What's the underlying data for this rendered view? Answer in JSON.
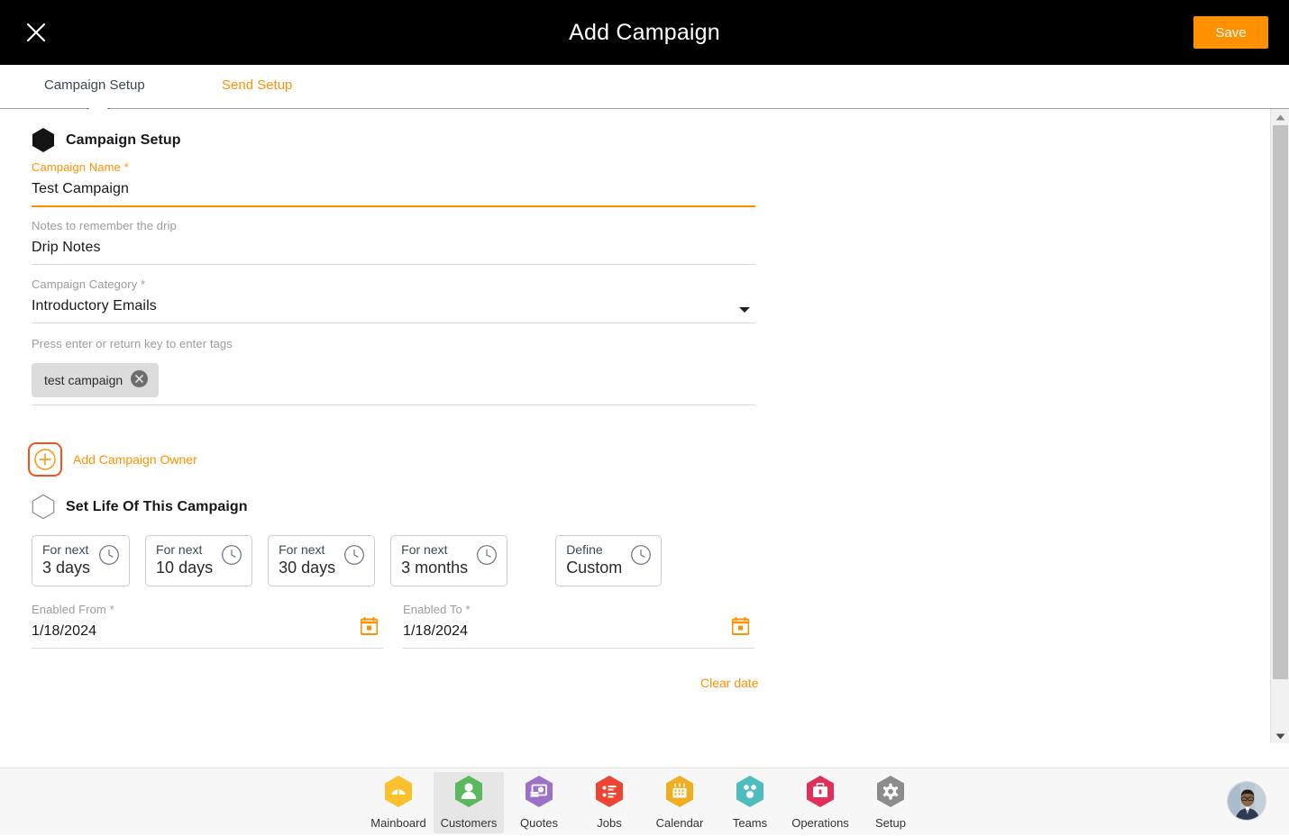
{
  "header": {
    "title": "Add Campaign",
    "close_icon": "close-icon",
    "save_label": "Save"
  },
  "tabs": [
    {
      "label": "Campaign Setup",
      "active": true
    },
    {
      "label": "Send Setup",
      "active": false
    }
  ],
  "sections": {
    "campaign_setup": {
      "title": "Campaign Setup",
      "icon": "hexagon-filled-icon"
    },
    "set_life": {
      "title": "Set Life Of This Campaign",
      "icon": "hexagon-outline-icon"
    }
  },
  "fields": {
    "campaign_name": {
      "label": "Campaign Name",
      "required_mark": "*",
      "value": "Test Campaign"
    },
    "notes": {
      "label": "Notes to remember the drip",
      "value": "Drip Notes"
    },
    "category": {
      "label": "Campaign Category",
      "required_mark": "*",
      "value": "Introductory Emails",
      "caret_icon": "chevron-down-icon"
    },
    "tags": {
      "label": "Press enter or return key to enter tags",
      "chips": [
        {
          "text": "test campaign",
          "remove_icon": "close-circle-icon"
        }
      ]
    },
    "enabled_from": {
      "label": "Enabled From",
      "required_mark": "*",
      "value": "1/18/2024",
      "calendar_icon": "calendar-icon"
    },
    "enabled_to": {
      "label": "Enabled To",
      "required_mark": "*",
      "value": "1/18/2024",
      "calendar_icon": "calendar-icon"
    }
  },
  "add_owner": {
    "label": "Add Campaign Owner",
    "icon": "plus-circle-icon"
  },
  "duration_cards": [
    {
      "top": "For next",
      "bottom": "3 days",
      "icon": "clock-icon"
    },
    {
      "top": "For next",
      "bottom": "10 days",
      "icon": "clock-icon"
    },
    {
      "top": "For next",
      "bottom": "30 days",
      "icon": "clock-icon"
    },
    {
      "top": "For next",
      "bottom": "3 months",
      "icon": "clock-icon"
    },
    {
      "top": "Define",
      "bottom": "Custom",
      "icon": "clock-icon"
    }
  ],
  "clear_date": {
    "label": "Clear date"
  },
  "scrollbar": {
    "up_icon": "triangle-up-icon",
    "down_icon": "triangle-down-icon"
  },
  "bottom_nav": [
    {
      "label": "Mainboard",
      "icon": "dashboard-hex-icon",
      "color": "#fbc02d",
      "active": false
    },
    {
      "label": "Customers",
      "icon": "person-hex-icon",
      "color": "#5cb85c",
      "active": true
    },
    {
      "label": "Quotes",
      "icon": "money-hex-icon",
      "color": "#9b72c7",
      "active": false
    },
    {
      "label": "Jobs",
      "icon": "checklist-hex-icon",
      "color": "#ee4433",
      "active": false
    },
    {
      "label": "Calendar",
      "icon": "calendar-hex-icon",
      "color": "#f0ad20",
      "active": false
    },
    {
      "label": "Teams",
      "icon": "teams-hex-icon",
      "color": "#4dbdbd",
      "active": false
    },
    {
      "label": "Operations",
      "icon": "briefcase-hex-icon",
      "color": "#e0305a",
      "active": false
    },
    {
      "label": "Setup",
      "icon": "gear-hex-icon",
      "color": "#8c8c8c",
      "active": false
    }
  ],
  "user_avatar": {
    "icon": "avatar-icon"
  },
  "colors": {
    "accent": "#ff9100",
    "focus_ring": "#f4511e",
    "topbar_bg": "#000000",
    "text": "#16181b",
    "muted": "#9c9c9c"
  }
}
